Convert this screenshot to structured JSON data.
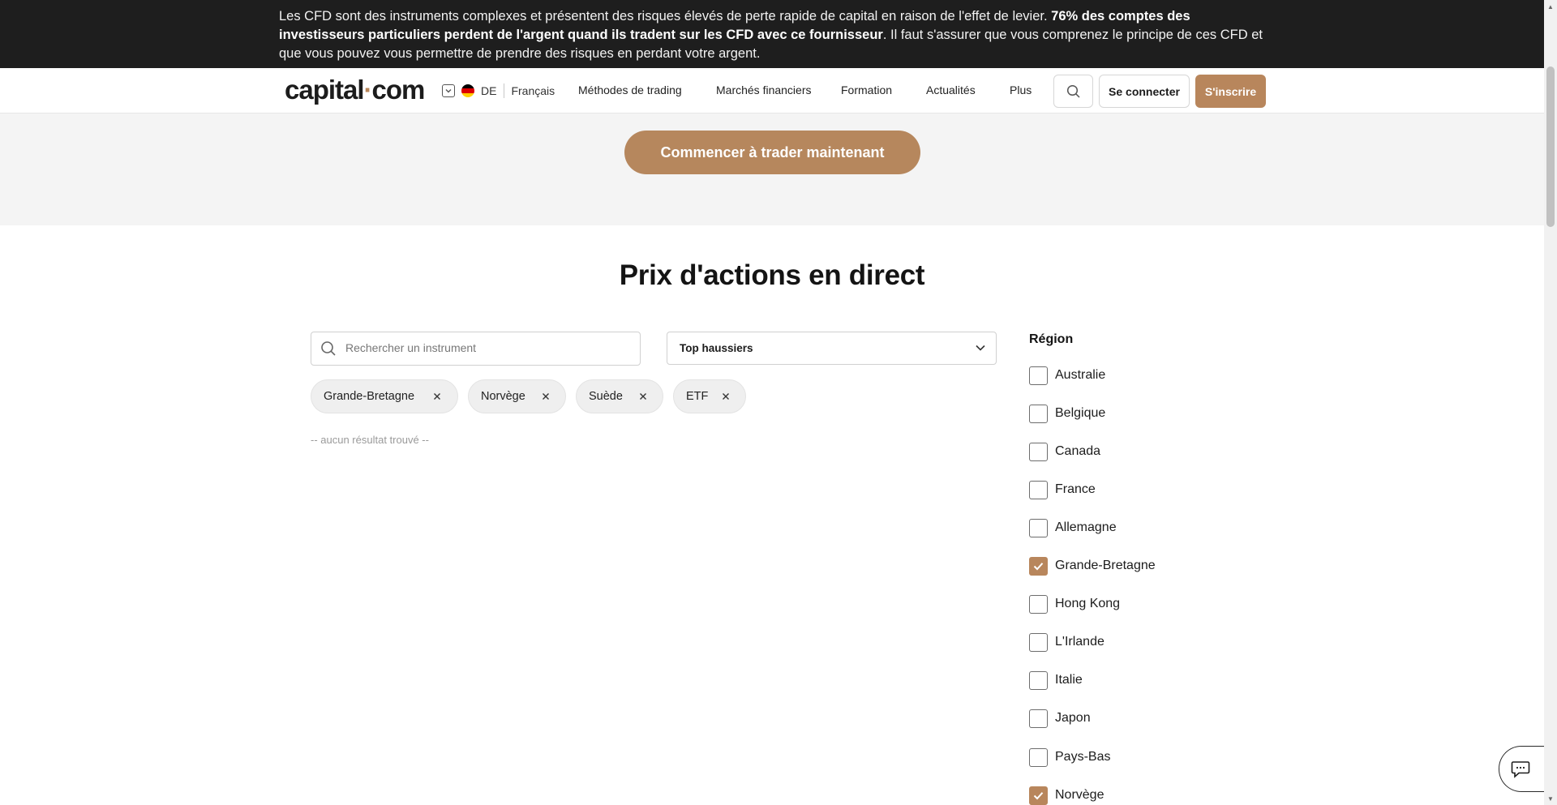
{
  "risk_banner": {
    "text_part1": "Les CFD sont des instruments complexes et présentent des risques élevés de perte rapide de capital en raison de l'effet de levier. ",
    "text_bold": "76% des comptes des investisseurs particuliers perdent de l'argent quand ils tradent sur les CFD avec ce fournisseur",
    "text_part2": ". Il faut s'assurer que vous comprenez le principe de ces CFD et que vous pouvez vous permettre de prendre des risques en perdant votre argent."
  },
  "header": {
    "logo_part1": "capital",
    "logo_dot": "·",
    "logo_part2": "com",
    "lang_code": "DE",
    "lang_name": "Français",
    "nav": [
      "Méthodes de trading",
      "Marchés financiers",
      "Formation",
      "Actualités",
      "Plus"
    ],
    "login_label": "Se connecter",
    "signup_label": "S'inscrire"
  },
  "cta": {
    "label": "Commencer à trader maintenant"
  },
  "main": {
    "title": "Prix d'actions en direct",
    "search_placeholder": "Rechercher un instrument",
    "sort_value": "Top haussiers",
    "chips": [
      "Grande-Bretagne",
      "Norvège",
      "Suède",
      "ETF"
    ],
    "no_result": "-- aucun résultat trouvé --"
  },
  "region": {
    "title": "Région",
    "items": [
      {
        "label": "Australie",
        "checked": false
      },
      {
        "label": "Belgique",
        "checked": false
      },
      {
        "label": "Canada",
        "checked": false
      },
      {
        "label": "France",
        "checked": false
      },
      {
        "label": "Allemagne",
        "checked": false
      },
      {
        "label": "Grande-Bretagne",
        "checked": true
      },
      {
        "label": "Hong Kong",
        "checked": false
      },
      {
        "label": "L'Irlande",
        "checked": false
      },
      {
        "label": "Italie",
        "checked": false
      },
      {
        "label": "Japon",
        "checked": false
      },
      {
        "label": "Pays-Bas",
        "checked": false
      },
      {
        "label": "Norvège",
        "checked": true
      }
    ]
  },
  "colors": {
    "accent": "#b8865c",
    "banner_bg": "#1e1e1e",
    "band_bg": "#f4f4f4"
  },
  "icons": {
    "search": "search-icon",
    "chevron": "chevron-down-icon",
    "close": "close-icon",
    "check": "check-icon",
    "chat": "chat-icon",
    "flag": "germany-flag-icon"
  }
}
